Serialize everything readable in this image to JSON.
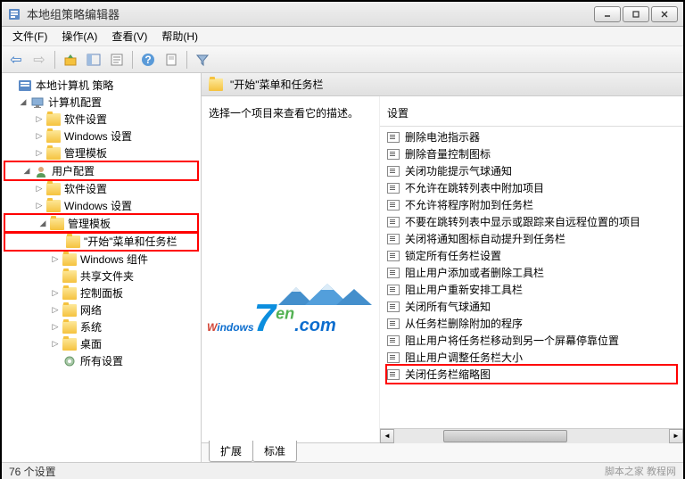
{
  "window": {
    "title": "本地组策略编辑器"
  },
  "menubar": {
    "items": [
      "文件(F)",
      "操作(A)",
      "查看(V)",
      "帮助(H)"
    ]
  },
  "tree": {
    "root": {
      "label": "本地计算机 策略"
    },
    "computer_config": {
      "label": "计算机配置"
    },
    "comp_software": {
      "label": "软件设置"
    },
    "comp_windows": {
      "label": "Windows 设置"
    },
    "comp_templates": {
      "label": "管理模板"
    },
    "user_config": {
      "label": "用户配置"
    },
    "user_software": {
      "label": "软件设置"
    },
    "user_windows": {
      "label": "Windows 设置"
    },
    "user_templates": {
      "label": "管理模板"
    },
    "start_taskbar": {
      "label": "\"开始\"菜单和任务栏"
    },
    "win_components": {
      "label": "Windows 组件"
    },
    "shared_folders": {
      "label": "共享文件夹"
    },
    "control_panel": {
      "label": "控制面板"
    },
    "network": {
      "label": "网络"
    },
    "system": {
      "label": "系统"
    },
    "desktop": {
      "label": "桌面"
    },
    "all_settings": {
      "label": "所有设置"
    }
  },
  "content": {
    "header_title": "\"开始\"菜单和任务栏",
    "description": "选择一个项目来查看它的描述。",
    "setting_header": "设置",
    "items": [
      "删除电池指示器",
      "删除音量控制图标",
      "关闭功能提示气球通知",
      "不允许在跳转列表中附加项目",
      "不允许将程序附加到任务栏",
      "不要在跳转列表中显示或跟踪来自远程位置的项目",
      "关闭将通知图标自动提升到任务栏",
      "锁定所有任务栏设置",
      "阻止用户添加或者删除工具栏",
      "阻止用户重新安排工具栏",
      "关闭所有气球通知",
      "从任务栏删除附加的程序",
      "阻止用户将任务栏移动到另一个屏幕停靠位置",
      "阻止用户调整任务栏大小",
      "关闭任务栏缩略图"
    ]
  },
  "tabs": {
    "extended": "扩展",
    "standard": "标准"
  },
  "statusbar": {
    "count": "76 个设置",
    "right": "脚本之家 教程网"
  },
  "icons": {
    "back": "⇦",
    "forward": "⇨"
  }
}
